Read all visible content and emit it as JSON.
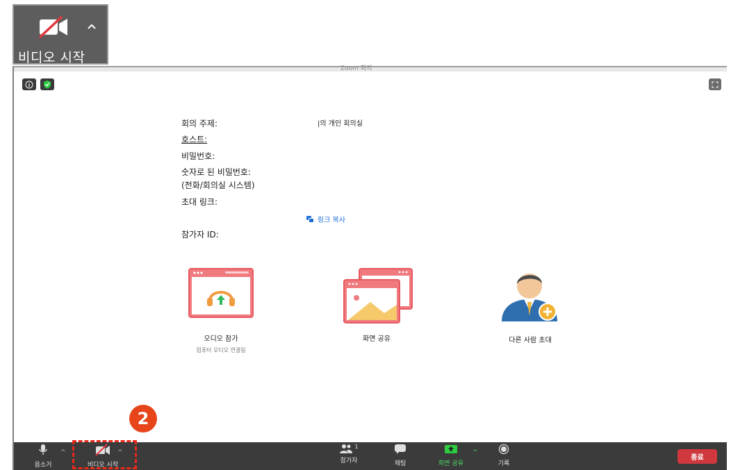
{
  "callout": {
    "label": "비디오 시작",
    "icon": "video-off-icon"
  },
  "window": {
    "title": "Zoom 회의"
  },
  "meeting_info": {
    "topic_label": "회의 주제:",
    "topic_value": "|의 개인 회의실",
    "host_label": "호스트:",
    "password_label": "비밀번호:",
    "numeric_password_label": "숫자로 된 비밀번호:",
    "numeric_password_sub": "(전화/회의실 시스템)",
    "invite_link_label": "초대 링크:",
    "copy_link": "링크 복사",
    "participant_id_label": "참가자 ID:"
  },
  "tiles": {
    "audio_title": "오디오 참가",
    "audio_sub": "컴퓨터 오디오 연결됨",
    "share_title": "화면 공유",
    "invite_title": "다른 사람 초대"
  },
  "toolbar": {
    "mute": "음소거",
    "video": "비디오 시작",
    "participants": "참가자",
    "participants_count": "1",
    "chat": "채팅",
    "share": "화면 공유",
    "record": "기록",
    "end": "종료"
  },
  "annotation": {
    "step": "2",
    "color": "#e8441a"
  }
}
